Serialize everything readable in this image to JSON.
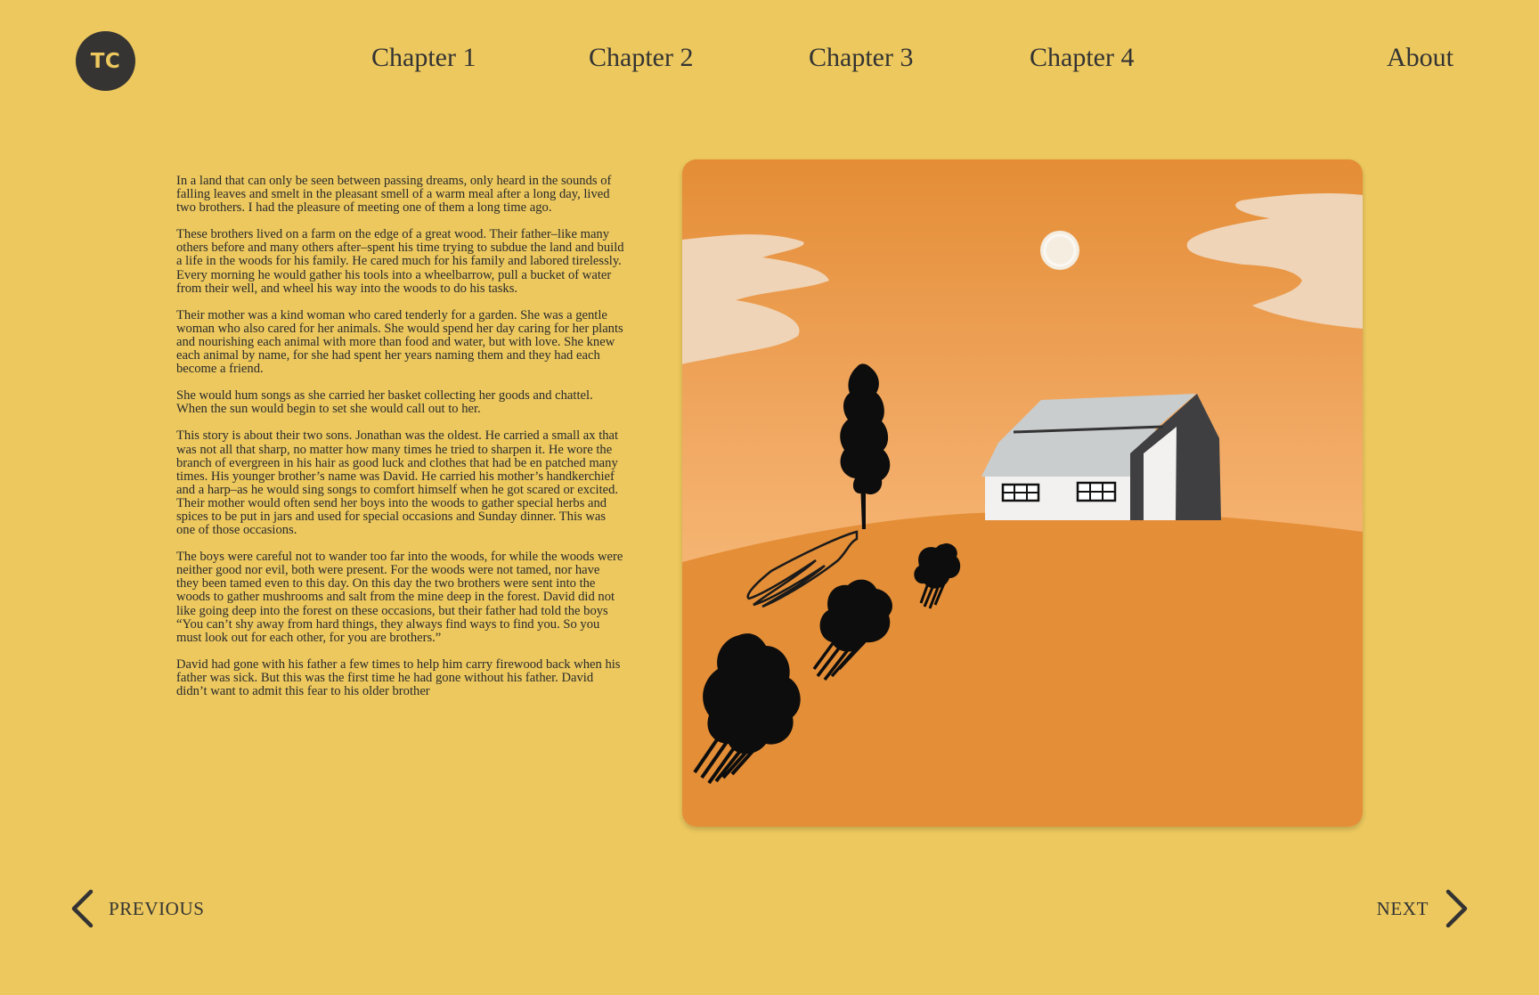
{
  "header": {
    "logo_text": "TC",
    "nav": {
      "chapter_1": "Chapter 1",
      "chapter_2": "Chapter 2",
      "chapter_3": "Chapter 3",
      "chapter_4": "Chapter 4",
      "about": "About"
    }
  },
  "story": {
    "paragraphs": [
      "In a land that can only be seen between passing dreams, only heard in the sounds of falling leaves and smelt in the pleasant smell of a warm meal after a long day, lived two brothers. I had the pleasure of meeting one of them a long time ago.",
      "These brothers lived on a farm on the edge of a great wood. Their father–like many others before and many others after–spent his time trying to subdue the land and build a life in the woods for his family. He cared much for his family and labored tirelessly. Every morning he would gather his tools into a wheelbarrow, pull a bucket of water from their well, and wheel his way into the woods to do his tasks.",
      "Their mother was a kind woman who cared tenderly for a garden. She was a gentle woman who also cared for her animals. She would spend her day caring for her plants and nourishing each animal with more than food and water, but with love. She knew each animal by name, for she had spent her years naming them and they had each become a friend.",
      " She would hum songs as she carried her basket collecting her goods and chattel. When the sun would begin to set she would call out to her.",
      "This story is about their two sons. Jonathan was the oldest. He carried a small ax that was not all that sharp, no matter how many times he tried to sharpen it. He wore the branch of evergreen in his hair as good luck and clothes that had be    en patched many times. His younger brother’s name was David. He carried his mother’s handkerchief and a harp–as he would sing songs to comfort himself when he got scared or excited. Their mother would often send her boys into the woods to gather special herbs and spices to be put in jars and used for special occasions and Sunday dinner. This was one of those occasions.",
      "The boys were careful not to wander too far into the woods, for while the woods were neither good nor evil, both were present. For the woods were not tamed, nor have they been tamed even to this day. On this day the two brothers were sent into the woods to gather mushrooms and salt from the mine deep in the forest. David did not like going deep into the forest on these occasions, but their father had told the boys “You can’t shy away from hard things, they always find ways to find you. So you must look out for each other, for you are brothers.”",
      "David had gone with his father a few times to help him carry firewood back when his father was sick. But this was the first time he had gone without his father. David didn’t want to admit this fear to his older brother"
    ]
  },
  "pager": {
    "previous_label": "PREVIOUS",
    "next_label": "NEXT"
  },
  "icons": {
    "prev": "chevron-left-icon",
    "next": "chevron-right-icon"
  },
  "colors": {
    "background": "#ECC85E",
    "logo_bg": "#363432",
    "illustration_orange": "#E48E37",
    "sky_light": "#F4B36E",
    "cloud": "#EFD4B8",
    "roof": "#C9CDCE",
    "house_dark": "#3F3F41"
  }
}
